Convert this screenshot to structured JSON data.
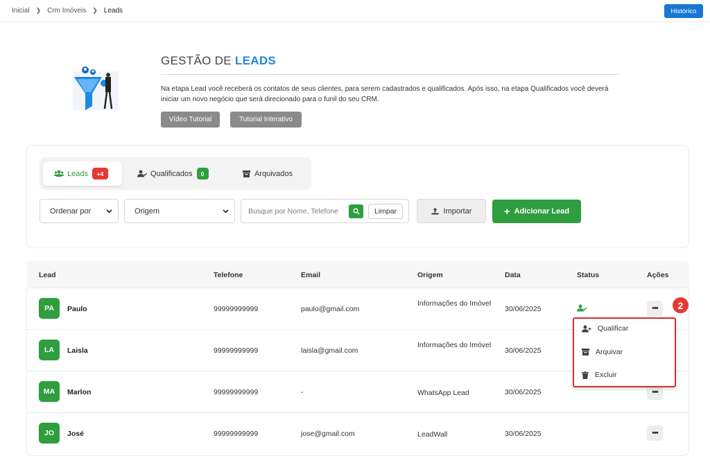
{
  "breadcrumb": {
    "items": [
      "Inicial",
      "Crm Imóveis",
      "Leads"
    ]
  },
  "header": {
    "history_label": "Histórico"
  },
  "hero": {
    "title_prefix": "GESTÃO DE ",
    "title_accent": "LEADS",
    "description": "Na etapa Lead você receberá os contatos de seus clientes, para serem cadastrados e qualificados. Após isso, na etapa Qualificados você deverá iniciar um novo negócio que será direcionado para o funil do seu CRM.",
    "video_tutorial_label": "Vídeo Tutorial",
    "interactive_tutorial_label": "Tutorial Interativo"
  },
  "tabs": [
    {
      "label": "Leads",
      "badge": "+4",
      "icon": "users-icon"
    },
    {
      "label": "Qualificados",
      "badge": "0",
      "icon": "user-check-icon"
    },
    {
      "label": "Arquivados",
      "icon": "archive-icon"
    }
  ],
  "filters": {
    "order_by": "Ordenar por",
    "origin": "Origem",
    "search_placeholder": "Busque por Nome, Telefone",
    "clear_label": "Limpar",
    "import_label": "Importar",
    "add_lead_label": "Adicionar Lead"
  },
  "table": {
    "columns": [
      "Lead",
      "Telefone",
      "Email",
      "Origem",
      "Data",
      "Status",
      "Ações"
    ],
    "rows": [
      {
        "initials": "PA",
        "name": "Paulo",
        "phone": "99999999999",
        "email": "paulo@gmail.com",
        "origin": "Informações do Imóvel",
        "date": "30/06/2025"
      },
      {
        "initials": "LA",
        "name": "Laisla",
        "phone": "99999999999",
        "email": "laisla@gmail.com",
        "origin": "Informações do Imóvel",
        "date": "30/06/2025"
      },
      {
        "initials": "MA",
        "name": "Marlon",
        "phone": "99999999999",
        "email": "-",
        "origin": "WhatsApp Lead",
        "date": "30/06/2025"
      },
      {
        "initials": "JO",
        "name": "José",
        "phone": "99999999999",
        "email": "jose@gmail.com",
        "origin": "LeadWall",
        "date": "30/06/2025"
      }
    ],
    "actions_glyph": "•••"
  },
  "context_menu": {
    "items": [
      {
        "label": "Qualificar",
        "icon": "user-plus-icon"
      },
      {
        "label": "Arquivar",
        "icon": "archive-icon"
      },
      {
        "label": "Excluir",
        "icon": "trash-icon"
      }
    ]
  },
  "annotation": {
    "step": "2"
  },
  "colors": {
    "primary_blue": "#1976d2",
    "green": "#2e9e3e",
    "red": "#e53935",
    "gray_button": "#8a8a8a"
  }
}
